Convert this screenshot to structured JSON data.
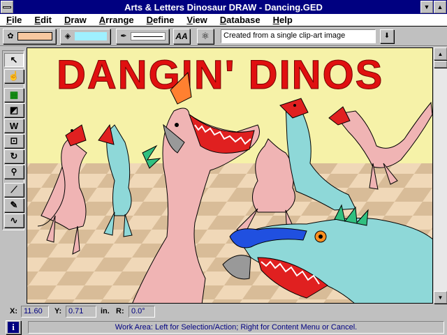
{
  "window": {
    "title": "Arts & Letters Dinosaur DRAW - Dancing.GED",
    "min_symbol": "▼",
    "max_symbol": "▲"
  },
  "menu": [
    {
      "key": "F",
      "rest": "ile"
    },
    {
      "key": "E",
      "rest": "dit"
    },
    {
      "key": "D",
      "rest": "raw"
    },
    {
      "key": "A",
      "rest": "rrange"
    },
    {
      "key": "D",
      "rest": "efine",
      "prefix": ""
    },
    {
      "key": "V",
      "rest": "iew"
    },
    {
      "key": "D",
      "rest": "atabase",
      "prefix": ""
    },
    {
      "key": "H",
      "rest": "elp"
    }
  ],
  "toolbar": {
    "fill_color": "#f8c8a0",
    "fill2_color": "#9ff0ff",
    "text_style_label": "AA",
    "description": "Created from a single clip-art image",
    "dropdown_symbol": "⬇"
  },
  "toolbox": [
    {
      "name": "selection-arrow-tool",
      "glyph": "↖"
    },
    {
      "name": "hand-tool",
      "glyph": "☝"
    },
    {
      "name": "clipart-library-tool",
      "glyph": "▦"
    },
    {
      "name": "shapes-tool",
      "glyph": "◩"
    },
    {
      "name": "text-tool",
      "glyph": "W"
    },
    {
      "name": "transform-tool",
      "glyph": "⊡"
    },
    {
      "name": "rotate-tool",
      "glyph": "↻"
    },
    {
      "name": "zoom-tool",
      "glyph": "🔍"
    },
    {
      "name": "line-tool",
      "glyph": "⟋"
    },
    {
      "name": "pencil-tool",
      "glyph": "✎"
    },
    {
      "name": "freehand-tool",
      "glyph": "∿"
    }
  ],
  "artwork": {
    "headline": "DANGIN' DINOS",
    "headline_color": "#e01010",
    "background_color": "#f6f2a8",
    "floor_light": "#f0d8b8",
    "floor_dark": "#d8bc98",
    "pink_dino_color": "#f0b4b4",
    "blue_dino_color": "#8ed8d8",
    "mouth_color": "#e02020",
    "teeth_color": "#ffffff",
    "crest_color": "#ff8030",
    "blue_crest_color": "#2050e0",
    "spike_color": "#30c080"
  },
  "coords": {
    "x_label": "X:",
    "x_value": "11.60",
    "y_label": "Y:",
    "y_value": "0.71",
    "unit": "in.",
    "r_label": "R:",
    "r_value": "0.0°"
  },
  "status": {
    "info_glyph": "i",
    "text": "Work Area: Left for Selection/Action; Right for Content Menu or Cancel."
  }
}
